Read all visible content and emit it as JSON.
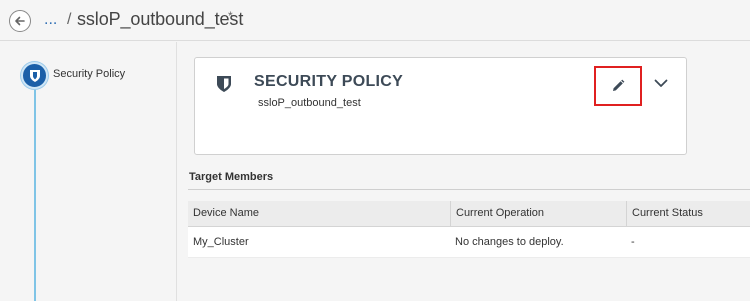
{
  "header": {
    "breadcrumb_ellipsis": "...",
    "breadcrumb_separator": "/",
    "title": "ssloP_outbound_test",
    "unsaved_marker": "*"
  },
  "steps": [
    {
      "label": "Security Policy",
      "icon": "shield-icon"
    }
  ],
  "card": {
    "title": "SECURITY POLICY",
    "subtitle": "ssloP_outbound_test",
    "icon": "shield-icon",
    "actions": [
      "pencil-icon",
      "chevron-down-icon"
    ]
  },
  "target_members": {
    "heading": "Target Members",
    "columns": [
      "Device Name",
      "Current Operation",
      "Current Status"
    ],
    "rows": [
      [
        "My_Cluster",
        "No changes to deploy.",
        "-"
      ]
    ]
  },
  "colors": {
    "accent": "#1b5fa8",
    "timeline": "#7fc4e6",
    "highlight": "#e02020",
    "link": "#2f6fb5"
  }
}
